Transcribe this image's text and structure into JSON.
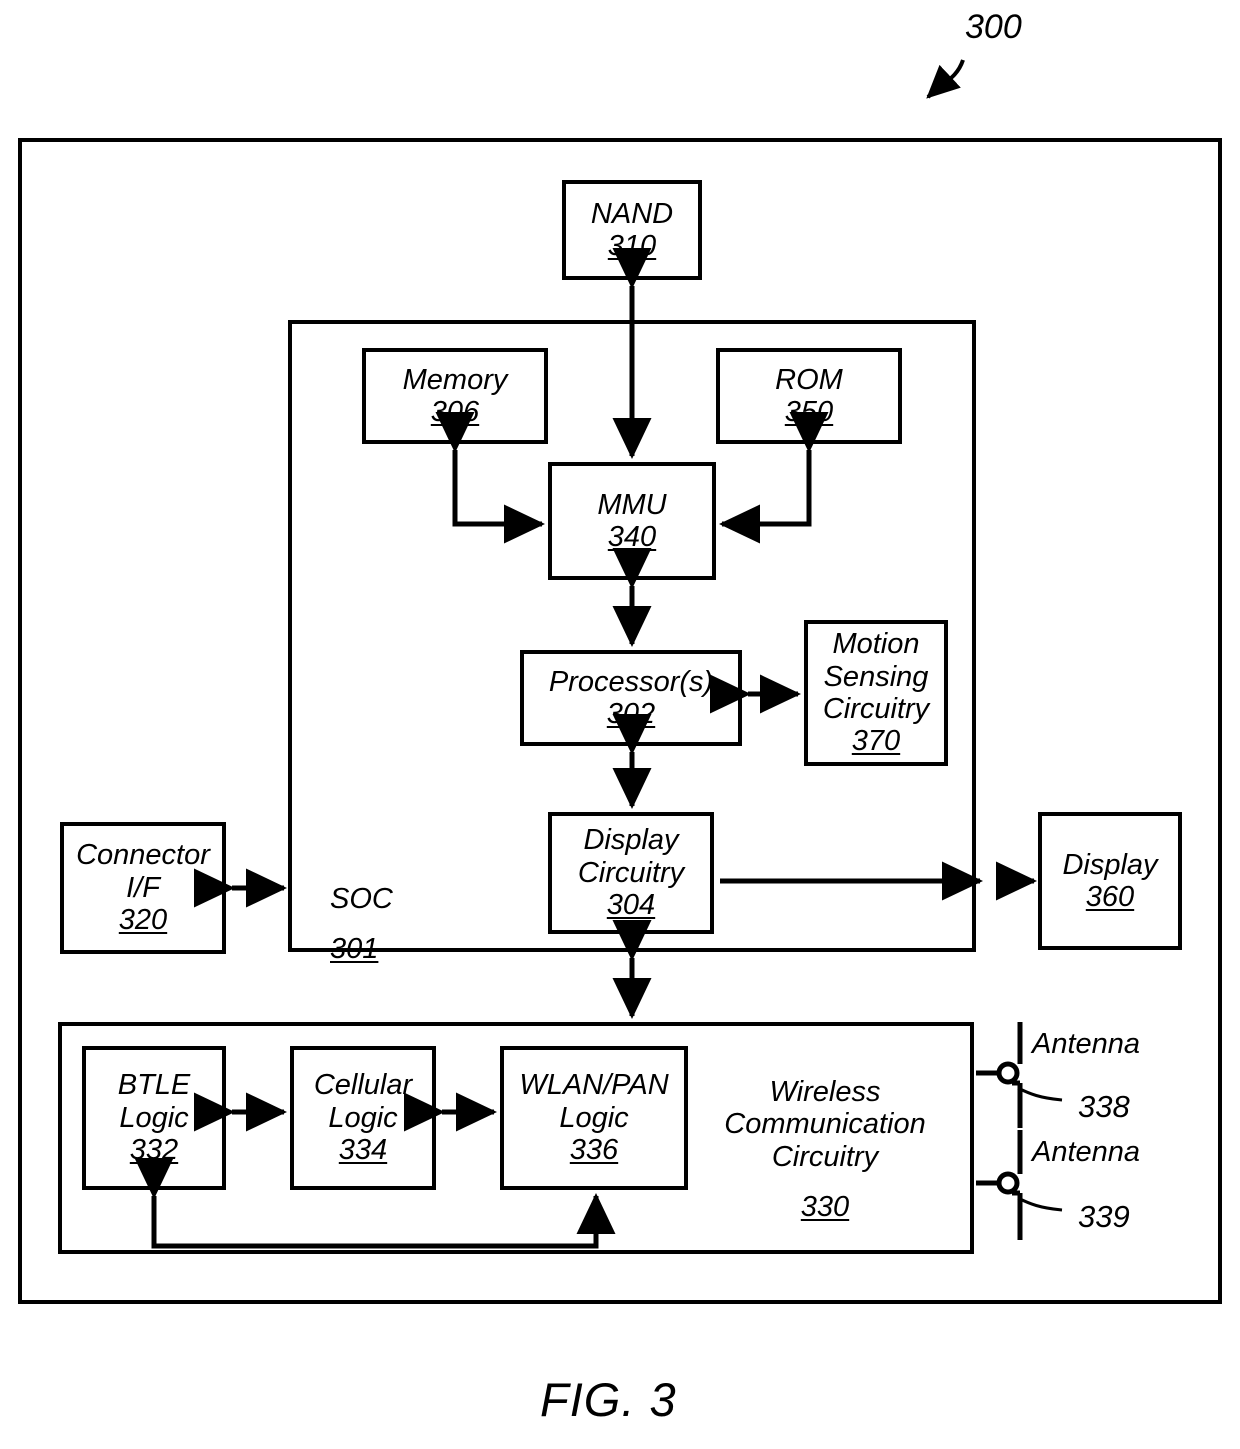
{
  "figure": {
    "caption": "FIG. 3",
    "ref_numeral": "300"
  },
  "soc": {
    "label": "SOC",
    "number": "301"
  },
  "blocks": {
    "nand": {
      "label": "NAND",
      "number": "310"
    },
    "memory": {
      "label": "Memory",
      "number": "306"
    },
    "rom": {
      "label": "ROM",
      "number": "350"
    },
    "mmu": {
      "label": "MMU",
      "number": "340"
    },
    "processor": {
      "label": "Processor(s)",
      "number": "302"
    },
    "motion": {
      "label": "Motion\nSensing\nCircuitry",
      "number": "370"
    },
    "display_circuitry": {
      "label": "Display\nCircuitry",
      "number": "304"
    },
    "connector": {
      "label": "Connector\nI/F",
      "number": "320"
    },
    "display": {
      "label": "Display",
      "number": "360"
    },
    "btle": {
      "label": "BTLE\nLogic",
      "number": "332"
    },
    "cellular": {
      "label": "Cellular\nLogic",
      "number": "334"
    },
    "wlanpan": {
      "label": "WLAN/PAN\nLogic",
      "number": "336"
    },
    "wireless": {
      "label": "Wireless\nCommunication\nCircuitry",
      "number": "330"
    }
  },
  "antennas": [
    {
      "label": "Antenna",
      "number": "338"
    },
    {
      "label": "Antenna",
      "number": "339"
    }
  ],
  "colors": {
    "line": "#000000",
    "background": "#ffffff"
  }
}
